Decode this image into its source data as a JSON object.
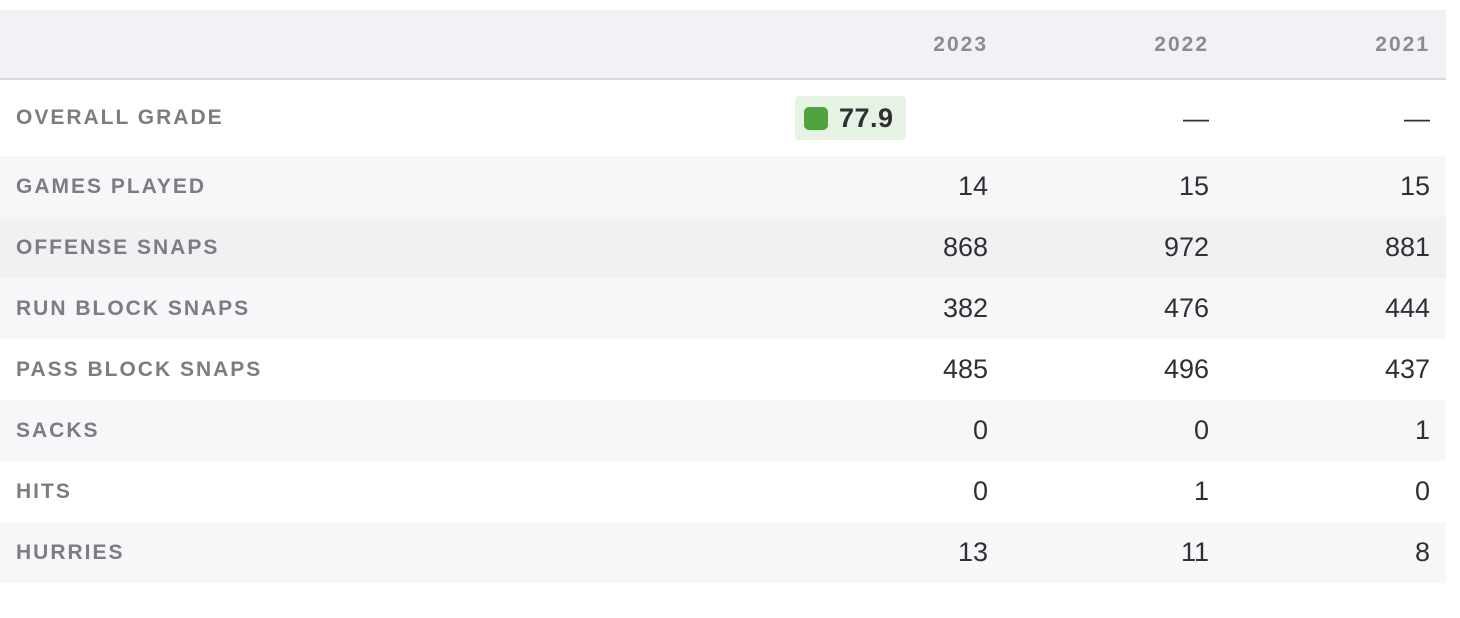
{
  "header": {
    "years": [
      "2023",
      "2022",
      "2021"
    ]
  },
  "colors": {
    "grade_green": "#4ea33f",
    "grade_badge_bg": "#e6f2e3"
  },
  "rows": [
    {
      "label": "OVERALL GRADE",
      "values": [
        "77.9",
        "—",
        "—"
      ]
    },
    {
      "label": "GAMES PLAYED",
      "values": [
        "14",
        "15",
        "15"
      ]
    },
    {
      "label": "OFFENSE SNAPS",
      "values": [
        "868",
        "972",
        "881"
      ]
    },
    {
      "label": "RUN BLOCK SNAPS",
      "values": [
        "382",
        "476",
        "444"
      ]
    },
    {
      "label": "PASS BLOCK SNAPS",
      "values": [
        "485",
        "496",
        "437"
      ]
    },
    {
      "label": "SACKS",
      "values": [
        "0",
        "0",
        "1"
      ]
    },
    {
      "label": "HITS",
      "values": [
        "0",
        "1",
        "0"
      ]
    },
    {
      "label": "HURRIES",
      "values": [
        "13",
        "11",
        "8"
      ]
    }
  ]
}
